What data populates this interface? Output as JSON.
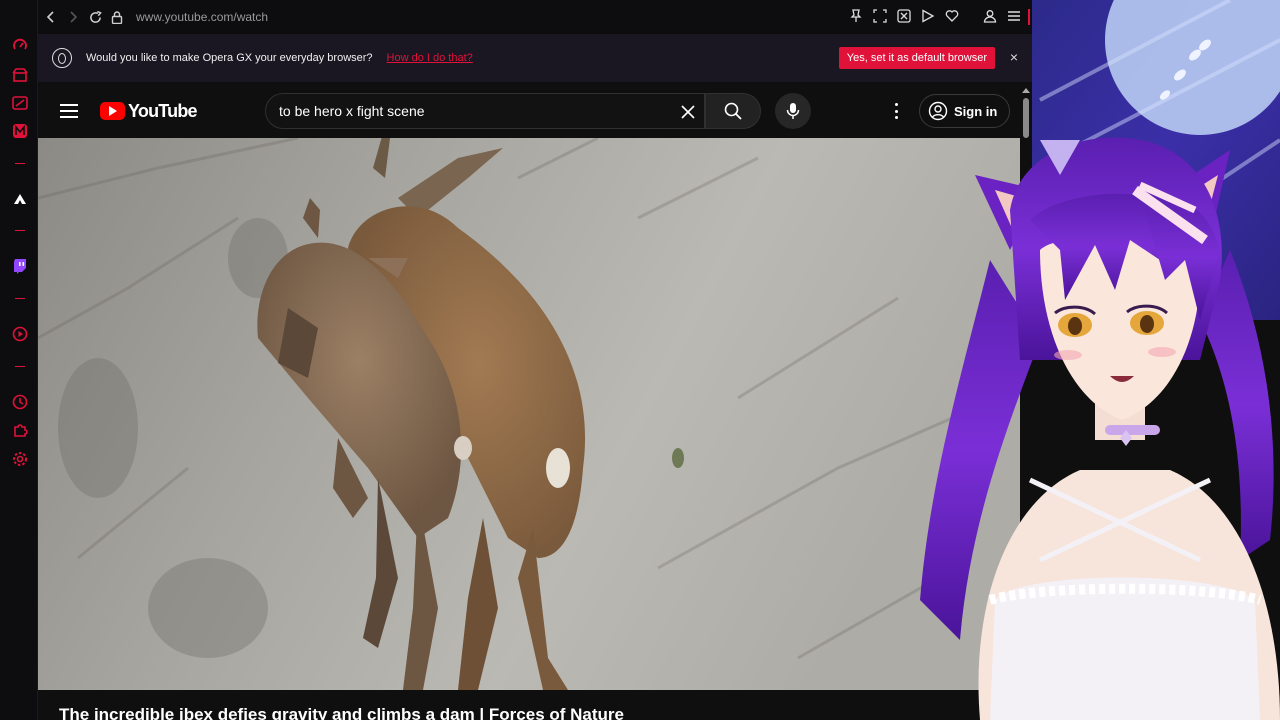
{
  "browser": {
    "url": "www.youtube.com/watch",
    "back_icon": "back-arrow-icon",
    "forward_icon": "forward-arrow-icon",
    "reload_icon": "reload-icon",
    "lock_icon": "lock-icon"
  },
  "banner": {
    "text": "Would you like to make Opera GX your everyday browser?",
    "link": "How do I do that?",
    "button": "Yes, set it as default browser",
    "close": "×"
  },
  "youtube": {
    "logo_text": "YouTube",
    "search_value": "to be hero x fight scene",
    "sign_in": "Sign in",
    "video_title": "The incredible ibex defies gravity and climbs a dam | Forces of Nature"
  },
  "colors": {
    "opera_accent": "#e0123a",
    "youtube_red": "#ff0000",
    "banner_bg": "#1b1722",
    "page_bg": "#0f0f0f"
  },
  "sidebar_icons": [
    "speed-dial-icon",
    "shop-icon",
    "news-icon",
    "mail-icon",
    "bookmark-icon",
    "twitch-icon",
    "player-icon",
    "history-icon",
    "extensions-icon",
    "settings-icon"
  ]
}
